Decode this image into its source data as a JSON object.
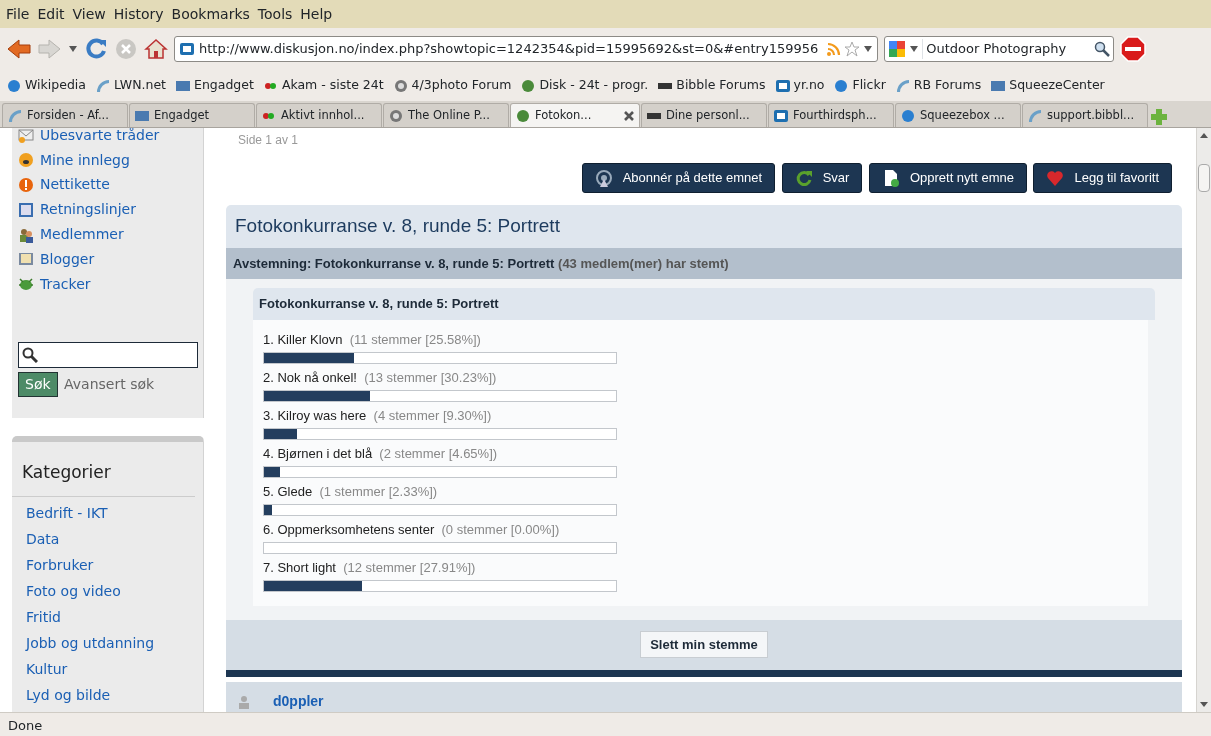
{
  "menu": [
    "File",
    "Edit",
    "View",
    "History",
    "Bookmarks",
    "Tools",
    "Help"
  ],
  "toolbar": {
    "url": "http://www.diskusjon.no/index.php?showtopic=1242354&pid=15995692&st=0&#entry159956",
    "search_value": "Outdoor Photography"
  },
  "bookmarks": [
    {
      "label": "Wikipedia"
    },
    {
      "label": "LWN.net"
    },
    {
      "label": "Engadget"
    },
    {
      "label": "Akam - siste 24t"
    },
    {
      "label": "4/3photo Forum"
    },
    {
      "label": "Disk - 24t - progr."
    },
    {
      "label": "Bibble Forums"
    },
    {
      "label": "yr.no"
    },
    {
      "label": "Flickr"
    },
    {
      "label": "RB Forums"
    },
    {
      "label": "SqueezeCenter"
    }
  ],
  "tabs": [
    {
      "label": "Forsiden - Af...",
      "selected": false
    },
    {
      "label": "Engadget",
      "selected": false
    },
    {
      "label": "Aktivt innhol...",
      "selected": false
    },
    {
      "label": "The Online P...",
      "selected": false
    },
    {
      "label": "Fotokon...",
      "selected": true
    },
    {
      "label": "Dine personl...",
      "selected": false
    },
    {
      "label": "Fourthirdsph...",
      "selected": false
    },
    {
      "label": "Squeezebox ...",
      "selected": false
    },
    {
      "label": "support.bibbl...",
      "selected": false
    }
  ],
  "sidebar": {
    "items": [
      "Ubesvarte tråder",
      "Mine innlegg",
      "Nettikette",
      "Retningslinjer",
      "Medlemmer",
      "Blogger",
      "Tracker"
    ],
    "search_button": "Søk",
    "advanced_search": "Avansert søk",
    "categories_title": "Kategorier",
    "categories": [
      "Bedrift - IKT",
      "Data",
      "Forbruker",
      "Foto og video",
      "Fritid",
      "Jobb og utdanning",
      "Kultur",
      "Lyd og bilde"
    ]
  },
  "page_info": "Side 1 av 1",
  "actions": [
    "Abonnér på dette emnet",
    "Svar",
    "Opprett nytt emne",
    "Legg til favoritt"
  ],
  "topic_title": "Fotokonkurranse v. 8, runde 5: Portrett",
  "poll": {
    "header": "Avstemning: Fotokonkurranse v. 8, runde 5: Portrett",
    "voters": "(43 medlem(mer) har stemt)",
    "question": "Fotokonkurranse v. 8, runde 5: Portrett",
    "options": [
      {
        "label": "1. Killer Klovn",
        "votes": "(11 stemmer [25.58%])",
        "level": 0.2558
      },
      {
        "label": "2. Nok nå onkel!",
        "votes": "(13 stemmer [30.23%])",
        "level": 0.3023
      },
      {
        "label": "3. Kilroy was here",
        "votes": "(4 stemmer [9.30%])",
        "level": 0.093
      },
      {
        "label": "4. Bjørnen i det blå",
        "votes": "(2 stemmer [4.65%])",
        "level": 0.0465
      },
      {
        "label": "5. Glede",
        "votes": "(1 stemmer [2.33%])",
        "level": 0.0233
      },
      {
        "label": "6. Oppmerksomhetens senter",
        "votes": "(0 stemmer [0.00%])",
        "level": 0
      },
      {
        "label": "7. Short light",
        "votes": "(12 stemmer [27.91%])",
        "level": 0.2791
      }
    ],
    "delete_vote": "Slett min stemme"
  },
  "next_post_author": "d0ppler",
  "status_bar": "Done"
}
